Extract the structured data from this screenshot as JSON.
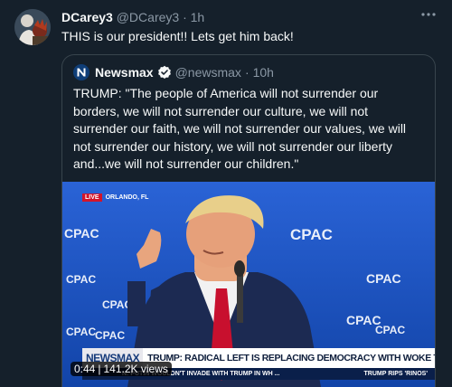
{
  "tweet": {
    "author_name": "DCarey3",
    "author_handle": "@DCarey3",
    "separator": "·",
    "time": "1h",
    "text": "THIS is our president!!  Lets get him back!",
    "more_icon": "more-horizontal-icon"
  },
  "quoted_tweet": {
    "author_name": "Newsmax",
    "author_handle": "@newsmax",
    "separator": "·",
    "time": "10h",
    "verified_icon": "verified-badge-icon",
    "text": "TRUMP: \"The people of America will not surrender our borders, we will not surrender our culture, we will not surrender our faith, we will not surrender our values, we will not surrender our history, we will not surrender our liberty and...we will not surrender our children.\""
  },
  "video": {
    "live_label": "LIVE",
    "location": "ORLANDO, FL",
    "brand": "NEWSMAX",
    "headline": "TRUMP: RADICAL LEFT IS REPLACING DEMOCRACY WITH WOKE TYRANNY",
    "ticker_left": "N: PUTIN WOULDN'T INVADE WITH TRUMP IN WH ...",
    "ticker_right": "TRUMP RIPS 'RINOS'",
    "duration": "0:44",
    "views": "141.2K views",
    "backdrop_text": "CPAC",
    "colors": {
      "backdrop": "#1a56c8",
      "brand_bar": "#153a7a",
      "live_red": "#d3142a"
    }
  },
  "colors": {
    "background": "#15202b",
    "text_primary": "#f7f9f9",
    "text_secondary": "#8b98a5",
    "border": "#38444d",
    "verified_blue": "#1d9bf0"
  }
}
